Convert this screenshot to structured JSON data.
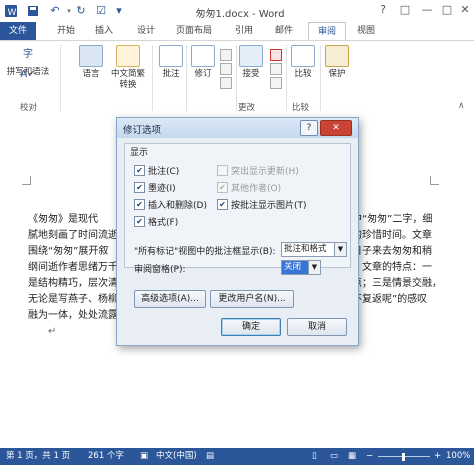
{
  "window": {
    "title": "匆匆1.docx - Word",
    "controls": [
      "?",
      "□",
      "—",
      "□",
      "✕"
    ]
  },
  "tabs": {
    "file": "文件",
    "items": [
      "开始",
      "插入",
      "设计",
      "页面布局",
      "引用",
      "邮件",
      "审阅",
      "视图"
    ],
    "active_index": 6
  },
  "ribbon": {
    "spelling": "拼写和语法",
    "language": "语言",
    "convert": "中文简繁\n转换",
    "comments": "批注",
    "track": "修订",
    "accept": "接受",
    "compare": "比较",
    "protect": "保护",
    "groups": {
      "proofing": "校对",
      "changes": "更改",
      "compare": "比较"
    }
  },
  "document": {
    "lines": [
      "《匆匆》是现代",
      "腻地刻画了时间流逝",
      "围绕“匆匆”展开叙",
      "纲间逝作者思绪万千",
      "是结构精巧，层次清",
      "无论是写燕子、杨柳",
      "融为一体，处处流露"
    ],
    "right_lines": [
      "中“匆匆”二字，细",
      "的珍惜时间。文章",
      "日子来去匆匆和稍",
      "。文章的特点：一",
      "点；三是情景交融，",
      "不复返呢”的感叹",
      ""
    ]
  },
  "dialog": {
    "title": "修订选项",
    "help": "?",
    "close": "✕",
    "section": "显示",
    "left_checks": [
      "批注(C)",
      "墨迹(I)",
      "插入和删除(D)",
      "格式(F)"
    ],
    "right_checks": [
      "突出显示更新(H)",
      "其他作者(O)",
      "按批注显示图片(T)"
    ],
    "balloon_label": "\"所有标记\"视图中的批注框显示(B):",
    "balloon_value": "批注和格式",
    "pane_label": "审阅窗格(P):",
    "pane_value": "关闭",
    "advanced": "高级选项(A)...",
    "change_user": "更改用户名(N)...",
    "ok": "确定",
    "cancel": "取消"
  },
  "status": {
    "page": "第 1 页，共 1 页",
    "words": "261 个字",
    "lang": "中文(中国)",
    "zoom": "100%"
  },
  "colors": {
    "accent": "#2b579a",
    "close": "#c84535"
  }
}
